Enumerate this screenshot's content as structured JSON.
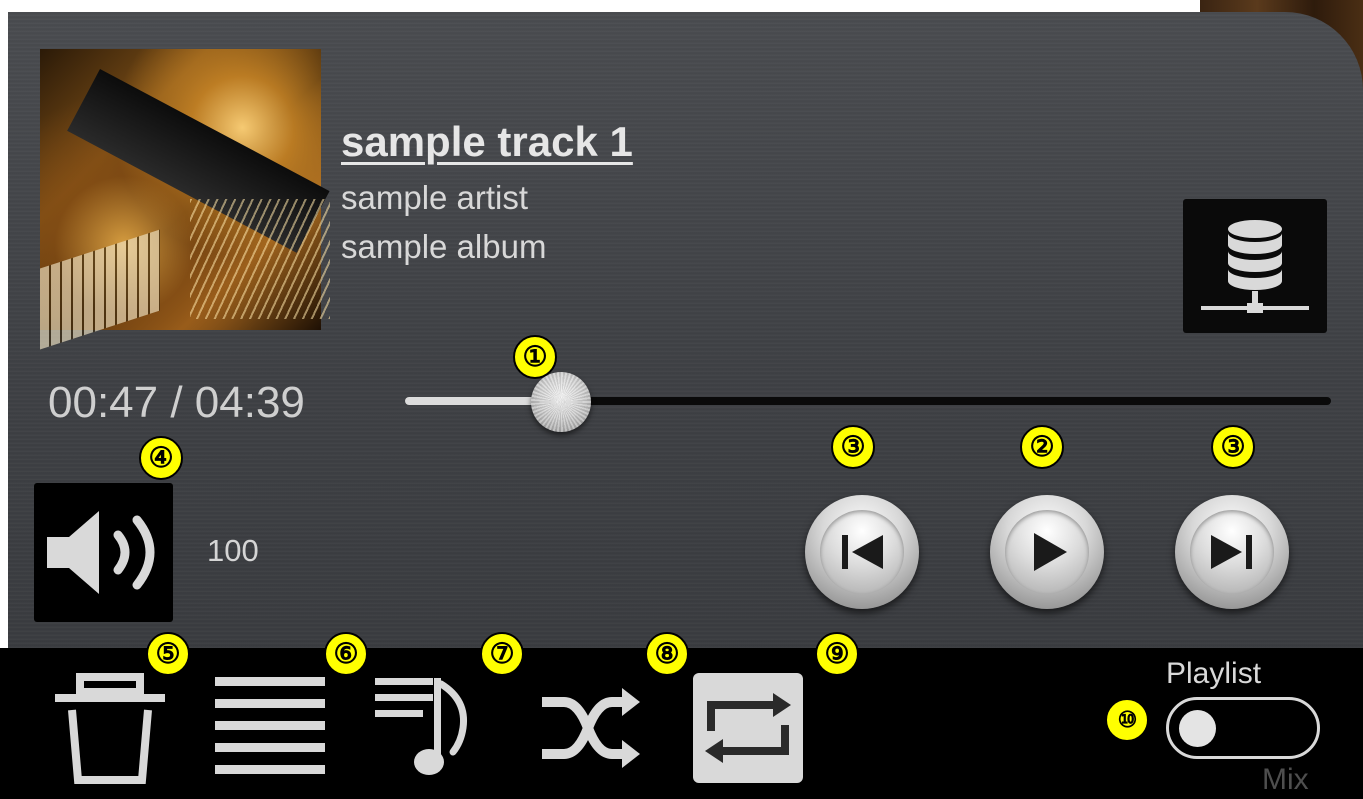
{
  "track": {
    "title": "sample track 1",
    "artist": "sample artist",
    "album": "sample album"
  },
  "playback": {
    "time": "00:47 / 04:39",
    "progress_fraction": 0.168
  },
  "volume": {
    "value": "100"
  },
  "playlist_mode": {
    "playlist_label": "Playlist",
    "mix_label": "Mix"
  },
  "markers": {
    "seek": "①",
    "play": "②",
    "previous": "③",
    "next": "③",
    "volume": "④",
    "delete": "⑤",
    "list": "⑥",
    "queue": "⑦",
    "shuffle": "⑧",
    "repeat": "⑨",
    "mode": "⑩"
  },
  "icons": {
    "server": "media-server-icon",
    "volume": "speaker-icon",
    "previous": "skip-previous-icon",
    "play": "play-icon",
    "next": "skip-next-icon",
    "delete": "trash-icon",
    "list": "list-icon",
    "queue": "playlist-music-icon",
    "shuffle": "shuffle-icon",
    "repeat": "repeat-icon"
  },
  "colors": {
    "marker": "#ffff00",
    "panel": "#404246",
    "bar": "#000000",
    "icon": "#d9d9d9"
  }
}
